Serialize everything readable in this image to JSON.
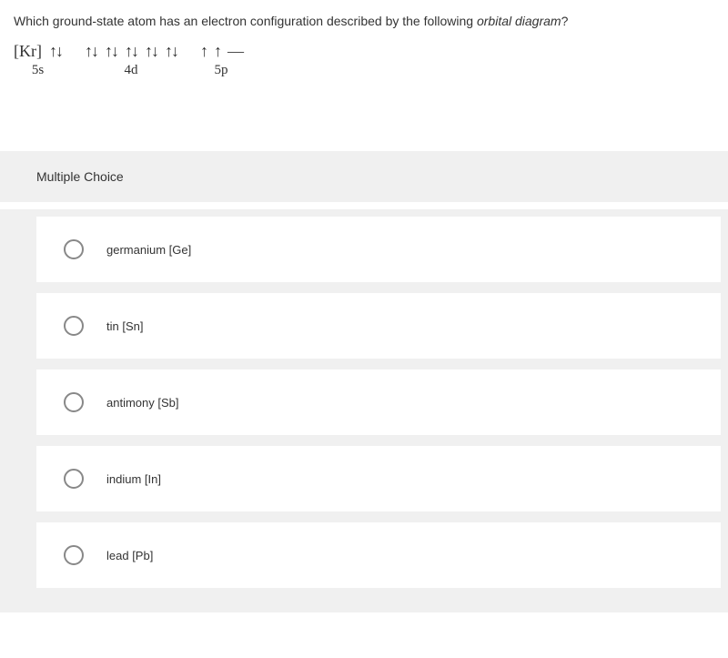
{
  "question": {
    "prefix": "Which ground-state atom has an electron configuration described by the following ",
    "italic": "orbital diagram",
    "suffix": "?"
  },
  "diagram": {
    "core": "[Kr]",
    "orbitals": [
      {
        "arrows": [
          "↑↓"
        ],
        "label": "5s"
      },
      {
        "arrows": [
          "↑↓",
          "↑↓",
          "↑↓",
          "↑↓",
          "↑↓"
        ],
        "label": "4d"
      },
      {
        "arrows": [
          "↑",
          "↑",
          "—"
        ],
        "label": "5p"
      }
    ]
  },
  "mc_header": "Multiple Choice",
  "options": [
    {
      "label": "germanium [Ge]"
    },
    {
      "label": "tin [Sn]"
    },
    {
      "label": "antimony [Sb]"
    },
    {
      "label": "indium [In]"
    },
    {
      "label": "lead [Pb]"
    }
  ]
}
